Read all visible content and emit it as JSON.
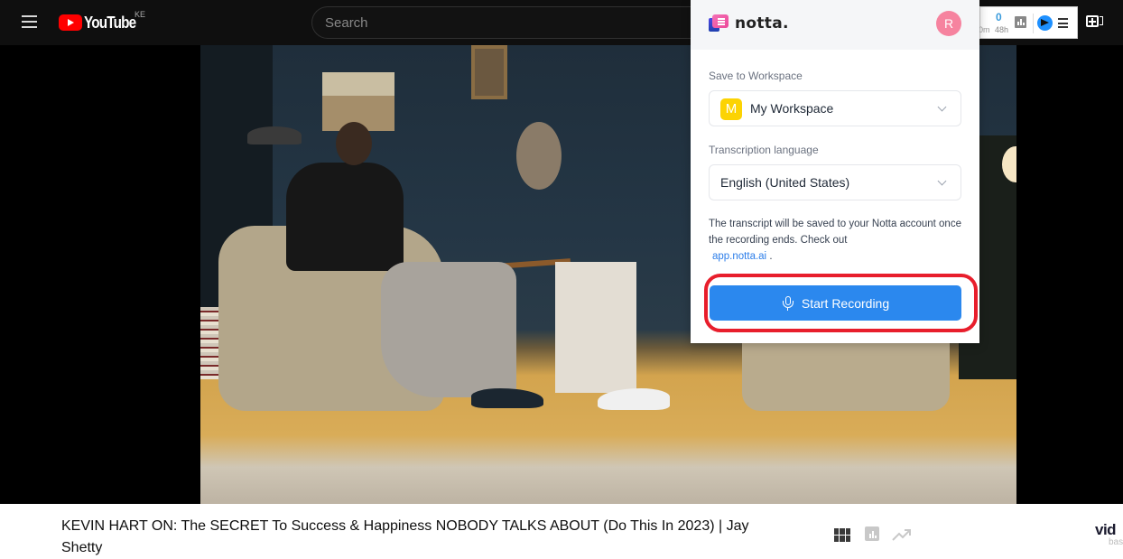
{
  "youtube": {
    "logo_text": "YouTube",
    "country_code": "KE",
    "search_placeholder": "Search",
    "search_value": ""
  },
  "extension_toolbar": {
    "count": "0",
    "time_left": "0m",
    "time": "48h"
  },
  "notta": {
    "brand": "notta.",
    "avatar_initial": "R",
    "workspace_label": "Save to Workspace",
    "workspace_badge": "M",
    "workspace_value": "My Workspace",
    "language_label": "Transcription language",
    "language_value": "English (United States)",
    "info_text": "The transcript will be saved to your Notta account once the recording ends. Check out",
    "info_link": "app.notta.ai",
    "info_suffix": ".",
    "start_recording_label": "Start Recording",
    "colors": {
      "primary": "#2b88ee",
      "avatar": "#f6839f",
      "workspace_badge": "#fcd303",
      "highlight": "#e81e2c"
    }
  },
  "video": {
    "title": "KEVIN HART ON: The SECRET To Success & Happiness NOBODY TALKS ABOUT (Do This In 2023) | Jay Shetty"
  },
  "vidiq_panel": {
    "brand": "vid",
    "brand_sub": "bas"
  }
}
